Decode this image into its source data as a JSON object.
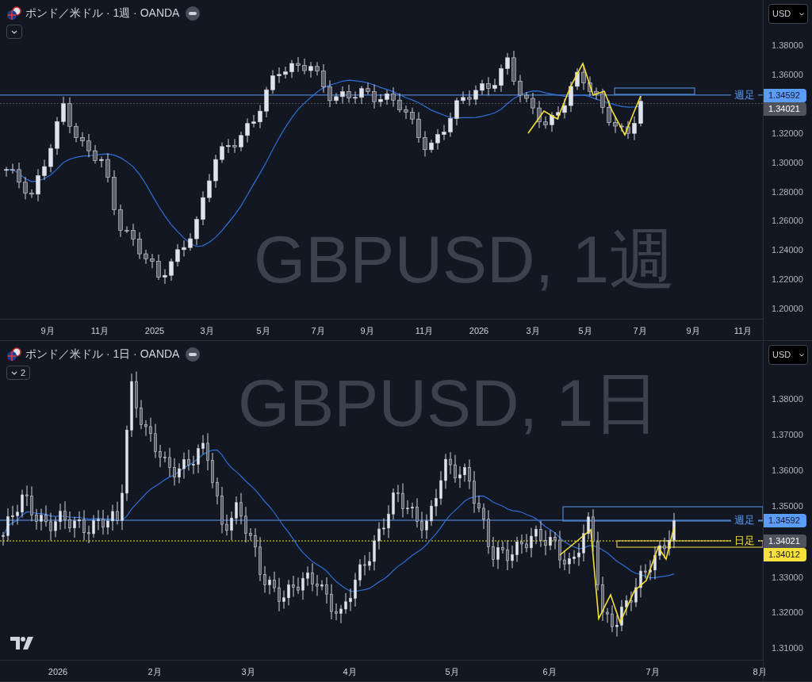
{
  "panes": [
    {
      "kind": "weekly",
      "title": "ポンド／米ドル · 1週 · OANDA",
      "watermark": "GBPUSD, 1週",
      "currency": "USD",
      "price_ticks": [
        "1.38000",
        "1.36000",
        "1.32000",
        "1.30000",
        "1.28000",
        "1.26000",
        "1.24000",
        "1.22000",
        "1.20000"
      ],
      "time_labels": [
        "9月",
        "11月",
        "2025",
        "3月",
        "5月",
        "7月",
        "9月",
        "11月",
        "2026",
        "3月",
        "5月",
        "7月",
        "9月",
        "11月"
      ],
      "price_tags": [
        {
          "kind": "line",
          "text": "1.34592",
          "color": "#5b9cf6",
          "line_label": "週足"
        },
        {
          "kind": "dotted",
          "text": "1.34021",
          "color": "#50535e"
        }
      ]
    },
    {
      "kind": "daily",
      "title": "ポンド／米ドル · 1日 · OANDA",
      "collapse_count": "2",
      "watermark": "GBPUSD, 1日",
      "currency": "USD",
      "price_ticks": [
        "1.38000",
        "1.37000",
        "1.36000",
        "1.35000",
        "1.33000",
        "1.32000",
        "1.31000"
      ],
      "time_labels": [
        "2026",
        "2月",
        "3月",
        "4月",
        "5月",
        "6月",
        "7月",
        "8月"
      ],
      "price_tags": [
        {
          "kind": "line",
          "text": "1.34592",
          "color": "#5b9cf6",
          "line_label": "週足"
        },
        {
          "kind": "plain",
          "text": "1.34021",
          "color": "#50535e"
        },
        {
          "kind": "dotted",
          "text": "1.34012",
          "color": "#f5e13a",
          "line_label": "日足"
        }
      ]
    }
  ]
}
